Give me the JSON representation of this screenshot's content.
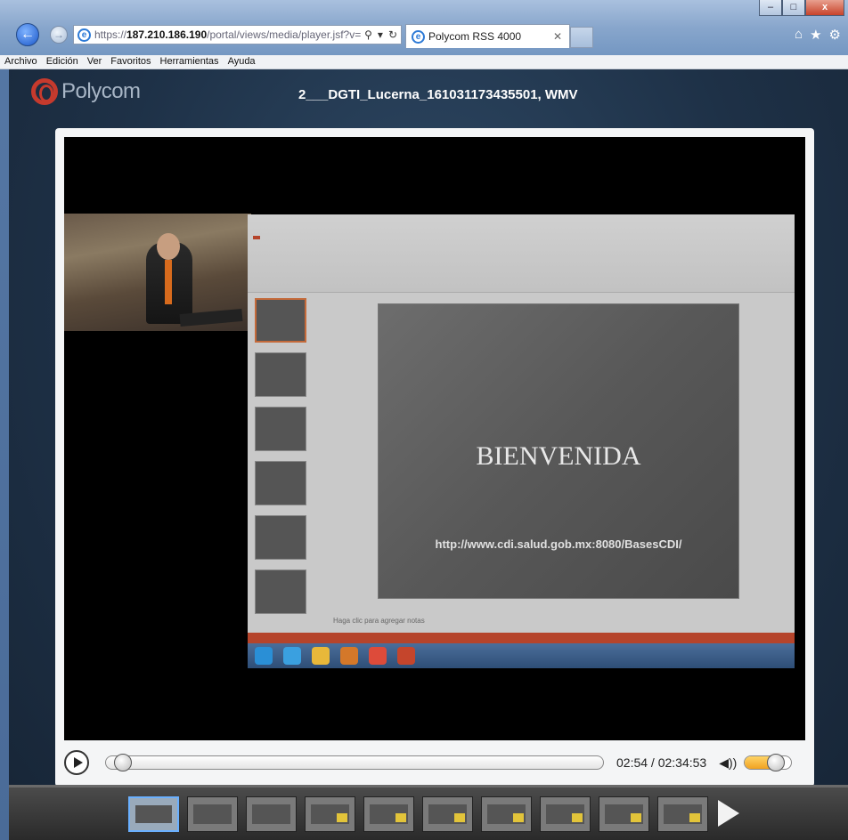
{
  "browser": {
    "url_prefix": "https://",
    "url_host": "187.210.186.190",
    "url_path": "/portal/views/media/player.jsf?v=",
    "tab_title": "Polycom RSS 4000",
    "menu": [
      "Archivo",
      "Edición",
      "Ver",
      "Favoritos",
      "Herramientas",
      "Ayuda"
    ],
    "icons": [
      "back-arrow-icon",
      "forward-arrow-icon",
      "home-icon",
      "star-icon",
      "gear-icon"
    ]
  },
  "page": {
    "logo_text": "Polycom",
    "title": "2___DGTI_Lucerna_161031173435501, WMV"
  },
  "video": {
    "slide_title": "BIENVENIDA",
    "slide_url": "http://www.cdi.salud.gob.mx:8080/BasesCDI/",
    "notes_placeholder": "Haga clic para agregar notas"
  },
  "controls": {
    "time_display": "02:54 / 02:34:53",
    "playback_progress": 0.019,
    "volume_level": 0.6
  },
  "filmstrip": {
    "frame_count": 10
  },
  "colors": {
    "accent_orange": "#f1a221",
    "ppt_red": "#b5442b",
    "polycom_red": "#c63a2d"
  }
}
